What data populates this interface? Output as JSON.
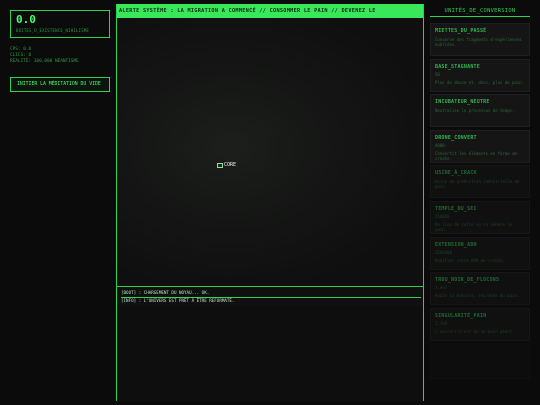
{
  "left": {
    "counter_value": "0.0",
    "counter_unit": "BOITES_D_EXISTENCE_NIHILISME",
    "stats": [
      "CPS: 0.0",
      "CLICS: 0",
      "RÉALITÉ: 100,000 NÉANTISME"
    ],
    "action_label": "INITIER LA MÉDITATION DU VIDE"
  },
  "center": {
    "ticker": "ALERTE SYSTÈME : LA MIGRATION A COMMENCÉ // CONSOMMER LE PAIN // DEVENEZ LE",
    "core_label": "CORE",
    "console": [
      "[BOOT] : CHARGEMENT DU NOYAU... OK.",
      "[INFO] : L'UNIVERS EST PRÊT À ÊTRE REFORMATÉ."
    ]
  },
  "right": {
    "title": "UNITÉS_DE_CONVERSION",
    "cards": [
      {
        "name": "MIETTES_DU_PASSÉ",
        "meta": "",
        "desc": "Conserve des fragments d'expériences oubliées."
      },
      {
        "name": "BASE_STAGNANTE",
        "meta": "50",
        "desc": "Plus de douce et, donc, plus de pain."
      },
      {
        "name": "INCUBATEUR_NEUTRE",
        "meta": "",
        "desc": "Neutralise le processus de temps."
      },
      {
        "name": "DRONE_CONVERT",
        "meta": "4000",
        "desc": "Convertit les éléments en forme de croûte."
      },
      {
        "name": "USINE_À_CRACK",
        "meta": "",
        "desc": "Usine de production industrielle de pain."
      },
      {
        "name": "TEMPLE_DU_SEC",
        "meta": "150000",
        "desc": "Un lieu de culte où on vénère le pain."
      },
      {
        "name": "EXTENSION_ADN",
        "meta": "1200000",
        "desc": "Modifier votre ADN en croûte."
      },
      {
        "name": "TROU_NOIR_DE_FLOCONS",
        "meta": "1.4e7",
        "desc": "Avale la matière, recrache du pain."
      },
      {
        "name": "SINGULARITÉ_PAIN",
        "meta": "1.7e8",
        "desc": "L'univers n'est qu'un pain géant."
      },
      {
        "name": "",
        "meta": "",
        "desc": ""
      }
    ]
  }
}
